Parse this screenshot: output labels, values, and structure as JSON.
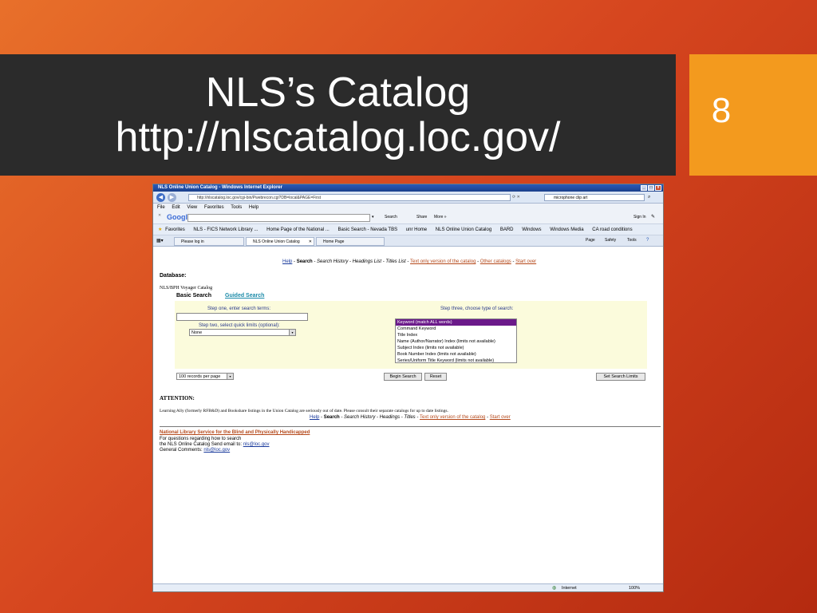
{
  "slide": {
    "title_line1": "NLS’s Catalog",
    "title_line2": "http://nlscatalog.loc.gov/",
    "slide_number": "8"
  },
  "browser": {
    "window_title": "NLS Online Union Catalog - Windows Internet Explorer",
    "url": "http://nlscatalog.loc.gov/cgi-bin/Pwebrecon.cgi?DB=local&PAGE=First",
    "search_box": "microphone clip art",
    "menu": [
      "File",
      "Edit",
      "View",
      "Favorites",
      "Tools",
      "Help"
    ],
    "google_label": "Google",
    "google_search": "Search",
    "google_share": "Share",
    "google_more": "More »",
    "sign_in": "Sign In",
    "favorites_label": "Favorites",
    "favorites": [
      "NLS - FICS Network Library ...",
      "Home Page of the National ...",
      "Basic Search - Nevada TBS",
      "unr Home",
      "NLS Online Union Catalog",
      "BARD",
      "Windows",
      "Windows Media",
      "CA road conditions"
    ],
    "tabs": [
      "Please log in",
      "NLS Online Union Catalog",
      "Home Page"
    ],
    "tools": [
      "Page",
      "Safety",
      "Tools"
    ],
    "status_zone": "Internet",
    "zoom": "100%"
  },
  "page": {
    "top_links": {
      "help": "Help",
      "sep1": " - ",
      "search": "Search",
      "rest": " - Search History - Headings List - Titles List - ",
      "text_only": "Text only version of the catalog",
      "sep2": " - ",
      "other": "Other catalogs",
      "sep3": " - ",
      "start_over": "Start over"
    },
    "database_label": "Database:",
    "database_name": "NLS/BPH Voyager Catalog",
    "tab_basic": "Basic Search",
    "tab_guided": "Guided Search",
    "step_one": "Step one, enter search terms:",
    "step_two": "Step two, select quick limits (optional):",
    "step_three": "Step three, choose type of search:",
    "limit_value": "None",
    "search_types": [
      "Keyword (match ALL words)",
      "Command Keyword",
      "Title Index",
      "Name (Author/Narrator) Index (limits not available)",
      "Subject Index (limits not available)",
      "Book Number Index (limits not available)",
      "Series/Uniform Title Keyword (limits not available)"
    ],
    "records_per_page": "100 records per page",
    "begin_search": "Begin Search",
    "reset": "Reset",
    "set_limits": "Set Search Limits",
    "attention": "ATTENTION:",
    "attention_text": "Learning Ally (formerly RFB&D) and Bookshare listings in the Union Catalog are seriously out of date. Please consult their separate catalogs for up to date listings.",
    "bottom_links": {
      "help": "Help",
      "sep1": " - ",
      "search": "Search",
      "rest": " - Search History - Headings - Titles - ",
      "text_only": "Text only version of the catalog",
      "sep2": " - ",
      "start_over": "Start over"
    },
    "footer_org": "National Library Service for the Blind and Physically Handicapped",
    "footer_line1": "For questions regarding how to search",
    "footer_line2": "the NLS Online Catalog Send email to: ",
    "footer_email1": "nls@loc.gov",
    "footer_line3": "General Comments: ",
    "footer_email2": "nls@loc.gov"
  }
}
